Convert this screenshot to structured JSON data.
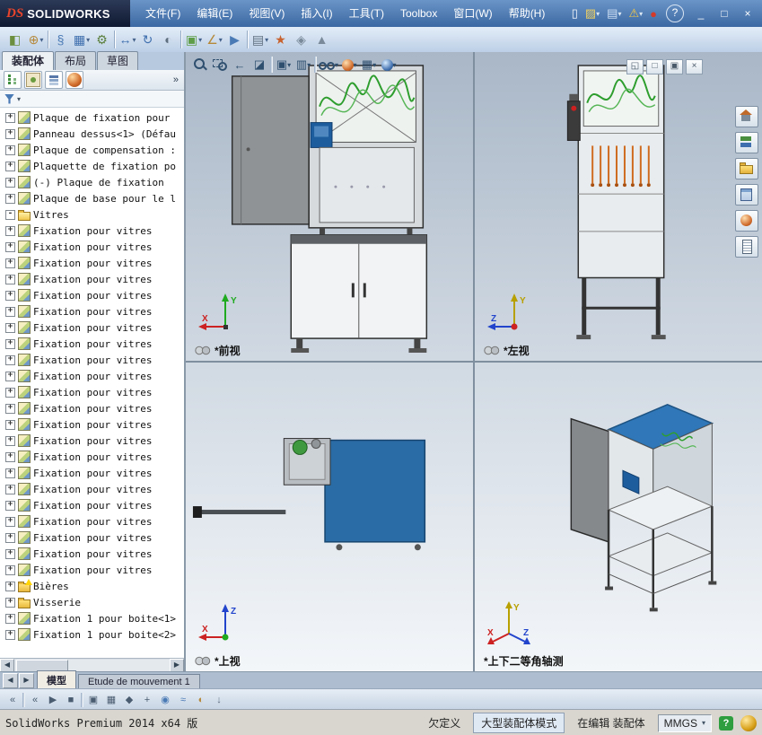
{
  "colors": {
    "accent_blue": "#2a6ca5",
    "titlebar_blue": "#3c68a2",
    "toolbar_bg": "#cfdcec",
    "viewport_top": "#a9b7c7",
    "status_green": "#2e9e3f",
    "model_panel_blue": "#2a6ca5"
  },
  "titlebar": {
    "logo_ds": "DS",
    "logo_text": "SOLIDWORKS",
    "menus": [
      {
        "id": "menu-file",
        "label": "文件(F)"
      },
      {
        "id": "menu-edit",
        "label": "编辑(E)"
      },
      {
        "id": "menu-view",
        "label": "视图(V)"
      },
      {
        "id": "menu-insert",
        "label": "插入(I)"
      },
      {
        "id": "menu-tools",
        "label": "工具(T)"
      },
      {
        "id": "menu-toolbox",
        "label": "Toolbox"
      },
      {
        "id": "menu-window",
        "label": "窗口(W)"
      },
      {
        "id": "menu-help",
        "label": "帮助(H)"
      }
    ],
    "quick_icons": [
      {
        "name": "new-document-icon",
        "glyph": "▯",
        "c": "color:#f5f8fb",
        "dd": ""
      },
      {
        "name": "open-icon",
        "glyph": "▨",
        "c": "color:#f0d060",
        "dd": "▾"
      },
      {
        "name": "save-icon",
        "glyph": "▤",
        "c": "color:#cfe0f4",
        "dd": "▾"
      },
      {
        "name": "options-warning-icon",
        "glyph": "⚠",
        "c": "color:#f5c844",
        "dd": "▾"
      },
      {
        "name": "traffic-light-icon",
        "glyph": "●",
        "c": "color:#d43a2a",
        "dd": ""
      }
    ],
    "help_glyph": "?",
    "window_controls": [
      {
        "name": "minimize-button",
        "glyph": "_"
      },
      {
        "name": "restore-button",
        "glyph": "□"
      },
      {
        "name": "close-button",
        "glyph": "×"
      }
    ]
  },
  "main_toolbar": {
    "icons": [
      {
        "name": "edit-component-icon",
        "glyph": "◧",
        "c": "color:#6b8f3e",
        "dd": "",
        "cls": "",
        "state": ""
      },
      {
        "name": "insert-components-icon",
        "glyph": "⊕",
        "c": "color:#b5893a",
        "dd": "▾",
        "cls": "",
        "state": ""
      },
      {
        "name": "separator",
        "glyph": "",
        "c": "",
        "dd": "",
        "cls": "sep",
        "state": ""
      },
      {
        "name": "mate-icon",
        "glyph": "§",
        "c": "color:#4a7ab5",
        "dd": "",
        "cls": "",
        "state": ""
      },
      {
        "name": "linear-component-pattern-icon",
        "glyph": "▦",
        "c": "color:#3f6fae",
        "dd": "▾",
        "cls": "",
        "state": ""
      },
      {
        "name": "smart-fasteners-icon",
        "glyph": "⚙",
        "c": "color:#5a7f3c",
        "dd": "",
        "cls": "",
        "state": ""
      },
      {
        "name": "separator",
        "glyph": "",
        "c": "",
        "dd": "",
        "cls": "sep",
        "state": ""
      },
      {
        "name": "move-component-icon",
        "glyph": "↔",
        "c": "color:#3f6fae",
        "dd": "▾",
        "cls": "",
        "state": ""
      },
      {
        "name": "rotate-component-icon",
        "glyph": "↻",
        "c": "color:#3f6fae",
        "dd": "",
        "cls": "",
        "state": ""
      },
      {
        "name": "show-hidden-components-icon",
        "glyph": "◐",
        "c": "color:#5f6f7f",
        "dd": "",
        "cls": "",
        "state": ""
      },
      {
        "name": "separator",
        "glyph": "",
        "c": "",
        "dd": "",
        "cls": "sep",
        "state": ""
      },
      {
        "name": "assembly-features-icon",
        "glyph": "▣",
        "c": "color:#5f9e49",
        "dd": "▾",
        "cls": "",
        "state": ""
      },
      {
        "name": "reference-geometry-icon",
        "glyph": "∠",
        "c": "color:#b5893a",
        "dd": "▾",
        "cls": "",
        "state": ""
      },
      {
        "name": "new-motion-study-icon",
        "glyph": "▶",
        "c": "color:#4a7ab5",
        "dd": "",
        "cls": "",
        "state": ""
      },
      {
        "name": "separator",
        "glyph": "",
        "c": "",
        "dd": "",
        "cls": "sep",
        "state": ""
      },
      {
        "name": "bill-of-materials-icon",
        "glyph": "▤",
        "c": "color:#5f6f7f",
        "dd": "▾",
        "cls": "",
        "state": ""
      },
      {
        "name": "exploded-view-icon",
        "glyph": "★",
        "c": "color:#c8622e",
        "dd": "",
        "cls": "",
        "state": ""
      },
      {
        "name": "interference-detection-icon",
        "glyph": "◈",
        "c": "color:#7a8a9a",
        "dd": "",
        "cls": "",
        "state": "dis"
      },
      {
        "name": "isolate-icon",
        "glyph": "▲",
        "c": "color:#7a8a9a",
        "dd": "",
        "cls": "",
        "state": "dis"
      }
    ]
  },
  "left_panel": {
    "tabs": [
      {
        "id": "tab-assembly",
        "label": "装配体",
        "cls": "active"
      },
      {
        "id": "tab-layout",
        "label": "布局",
        "cls": ""
      },
      {
        "id": "tab-sketch",
        "label": "草图",
        "cls": ""
      }
    ],
    "fm_tabs": [
      {
        "name": "featuremanager-tab-icon",
        "cls": "fmt-tree"
      },
      {
        "name": "propertymanager-tab-icon",
        "cls": "fmt-prop"
      },
      {
        "name": "configurationmanager-tab-icon",
        "cls": "fmt-config"
      },
      {
        "name": "displaymanager-tab-icon",
        "cls": "fmt-display"
      }
    ],
    "chevron": "»",
    "filter_arrow": "▾",
    "scroll_left": "◀",
    "scroll_right": "▶",
    "tree_items": [
      {
        "exp": "+",
        "icon": "t-part",
        "label": "Plaque de fixation pour"
      },
      {
        "exp": "+",
        "icon": "t-part",
        "label": "Panneau dessus<1> (Défau"
      },
      {
        "exp": "+",
        "icon": "t-part",
        "label": "Plaque de compensation :"
      },
      {
        "exp": "+",
        "icon": "t-part",
        "label": "Plaquette de fixation po"
      },
      {
        "exp": "+",
        "icon": "t-part",
        "label": "(-) Plaque de fixation"
      },
      {
        "exp": "+",
        "icon": "t-part",
        "label": "Plaque de base pour le l"
      },
      {
        "exp": "-",
        "icon": "t-folder-open",
        "label": "Vitres"
      },
      {
        "exp": "+",
        "icon": "t-part",
        "label": "Fixation pour vitres"
      },
      {
        "exp": "+",
        "icon": "t-part",
        "label": "Fixation pour vitres"
      },
      {
        "exp": "+",
        "icon": "t-part",
        "label": "Fixation pour vitres"
      },
      {
        "exp": "+",
        "icon": "t-part",
        "label": "Fixation pour vitres"
      },
      {
        "exp": "+",
        "icon": "t-part",
        "label": "Fixation pour vitres"
      },
      {
        "exp": "+",
        "icon": "t-part",
        "label": "Fixation pour vitres"
      },
      {
        "exp": "+",
        "icon": "t-part",
        "label": "Fixation pour vitres"
      },
      {
        "exp": "+",
        "icon": "t-part",
        "label": "Fixation pour vitres"
      },
      {
        "exp": "+",
        "icon": "t-part",
        "label": "Fixation pour vitres"
      },
      {
        "exp": "+",
        "icon": "t-part",
        "label": "Fixation pour vitres"
      },
      {
        "exp": "+",
        "icon": "t-part",
        "label": "Fixation pour vitres"
      },
      {
        "exp": "+",
        "icon": "t-part",
        "label": "Fixation pour vitres"
      },
      {
        "exp": "+",
        "icon": "t-part",
        "label": "Fixation pour vitres"
      },
      {
        "exp": "+",
        "icon": "t-part",
        "label": "Fixation pour vitres"
      },
      {
        "exp": "+",
        "icon": "t-part",
        "label": "Fixation pour vitres"
      },
      {
        "exp": "+",
        "icon": "t-part",
        "label": "Fixation pour vitres"
      },
      {
        "exp": "+",
        "icon": "t-part",
        "label": "Fixation pour vitres"
      },
      {
        "exp": "+",
        "icon": "t-part",
        "label": "Fixation pour vitres"
      },
      {
        "exp": "+",
        "icon": "t-part",
        "label": "Fixation pour vitres"
      },
      {
        "exp": "+",
        "icon": "t-part",
        "label": "Fixation pour vitres"
      },
      {
        "exp": "+",
        "icon": "t-part",
        "label": "Fixation pour vitres"
      },
      {
        "exp": "+",
        "icon": "t-part",
        "label": "Fixation pour vitres"
      },
      {
        "exp": "+",
        "icon": "t-warnfolder",
        "label": "Bières"
      },
      {
        "exp": "+",
        "icon": "t-folder",
        "label": "Visserie"
      },
      {
        "exp": "+",
        "icon": "t-part",
        "label": "Fixation 1 pour boite<1>"
      },
      {
        "exp": "+",
        "icon": "t-part",
        "label": "Fixation 1 pour boite<2>"
      }
    ]
  },
  "viewport": {
    "headsup_icons": [
      {
        "name": "zoom-fit-icon",
        "cls": "mi-zoom",
        "glyph": "",
        "dd": ""
      },
      {
        "name": "zoom-to-area-icon",
        "cls": "mi-zoomarea",
        "glyph": "",
        "dd": ""
      },
      {
        "name": "previous-view-icon",
        "cls": "",
        "glyph": "←",
        "dd": ""
      },
      {
        "name": "section-view-icon",
        "cls": "",
        "glyph": "◪",
        "dd": ""
      },
      {
        "name": "separator",
        "cls": "hsep",
        "glyph": "",
        "dd": ""
      },
      {
        "name": "view-orientation-icon",
        "cls": "",
        "glyph": "▣",
        "dd": "▾"
      },
      {
        "name": "display-style-icon",
        "cls": "",
        "glyph": "▥",
        "dd": "▾"
      },
      {
        "name": "separator",
        "cls": "hsep",
        "glyph": "",
        "dd": ""
      },
      {
        "name": "hide-show-items-icon",
        "cls": "mi-glasses",
        "glyph": "",
        "dd": "▾"
      },
      {
        "name": "edit-appearance-icon",
        "cls": "mi-ball",
        "glyph": "",
        "dd": "▾"
      },
      {
        "name": "apply-scene-icon",
        "cls": "",
        "glyph": "▦",
        "dd": "▾"
      },
      {
        "name": "view-settings-icon",
        "cls": "mi-ball2",
        "glyph": "",
        "dd": "▾"
      }
    ],
    "corner_controls": [
      {
        "name": "viewport-layout-icon",
        "glyph": "◱"
      },
      {
        "name": "viewport-maximize-icon",
        "glyph": "□"
      },
      {
        "name": "viewport-restore-icon",
        "glyph": "▣"
      },
      {
        "name": "viewport-close-icon",
        "glyph": "×"
      }
    ],
    "taskpane_tabs": [
      {
        "name": "home-tab-icon",
        "cls": "tp-home"
      },
      {
        "name": "solidworks-resources-tab-icon",
        "cls": "tp-resources"
      },
      {
        "name": "design-library-tab-icon",
        "cls": "tp-library"
      },
      {
        "name": "file-explorer-tab-icon",
        "cls": "tp-explorer"
      },
      {
        "name": "appearances-scenes-tab-icon",
        "cls": "tp-ball"
      },
      {
        "name": "custom-properties-tab-icon",
        "cls": "tp-props"
      }
    ],
    "views": [
      {
        "label": "*前视"
      },
      {
        "label": "*左视"
      },
      {
        "label": "*上视"
      },
      {
        "label": "*上下二等角轴测"
      }
    ]
  },
  "bottom": {
    "nav": [
      {
        "name": "sheet-scroll-left-button",
        "glyph": "◀"
      },
      {
        "name": "sheet-scroll-right-button",
        "glyph": "▶"
      }
    ],
    "tabs": [
      {
        "id": "tab-model",
        "label": "模型",
        "cls": "active"
      },
      {
        "id": "tab-motion-study-1",
        "label": "Etude de mouvement 1",
        "cls": ""
      }
    ]
  },
  "motion_toolbar": {
    "icons": [
      {
        "name": "collapse-motionmanager-icon",
        "glyph": "«",
        "c": "",
        "cls": "",
        "state": ""
      },
      {
        "name": "separator",
        "glyph": "",
        "c": "",
        "cls": "sep",
        "state": ""
      },
      {
        "name": "play-from-start-icon",
        "glyph": "«",
        "c": "",
        "cls": "",
        "state": "dis"
      },
      {
        "name": "play-icon",
        "glyph": "▶",
        "c": "",
        "cls": "",
        "state": "dis"
      },
      {
        "name": "stop-icon",
        "glyph": "■",
        "c": "",
        "cls": "",
        "state": "dis"
      },
      {
        "name": "separator",
        "glyph": "",
        "c": "",
        "cls": "sep",
        "state": ""
      },
      {
        "name": "save-animation-icon",
        "glyph": "▣",
        "c": "",
        "cls": "",
        "state": "dis"
      },
      {
        "name": "animation-wizard-icon",
        "glyph": "▦",
        "c": "",
        "cls": "",
        "state": "dis"
      },
      {
        "name": "auto-key-icon",
        "glyph": "◆",
        "c": "",
        "cls": "",
        "state": "dis"
      },
      {
        "name": "add-key-icon",
        "glyph": "+",
        "c": "",
        "cls": "",
        "state": "dis"
      },
      {
        "name": "motor-icon",
        "glyph": "◉",
        "c": "color:#4a7ab5",
        "cls": "",
        "state": ""
      },
      {
        "name": "spring-icon",
        "glyph": "≈",
        "c": "color:#4a7ab5",
        "cls": "",
        "state": ""
      },
      {
        "name": "contact-icon",
        "glyph": "◐",
        "c": "color:#b5893a",
        "cls": "",
        "state": ""
      },
      {
        "name": "gravity-icon",
        "glyph": "↓",
        "c": "color:#5f6f7f",
        "cls": "",
        "state": ""
      }
    ]
  },
  "statusbar": {
    "product": "SolidWorks Premium 2014 x64 版",
    "definition": "欠定义",
    "large_assembly_mode": "大型装配体模式",
    "editing": "在编辑 装配体",
    "units": "MMGS",
    "units_arrow": "▾",
    "help_glyph": "?"
  }
}
